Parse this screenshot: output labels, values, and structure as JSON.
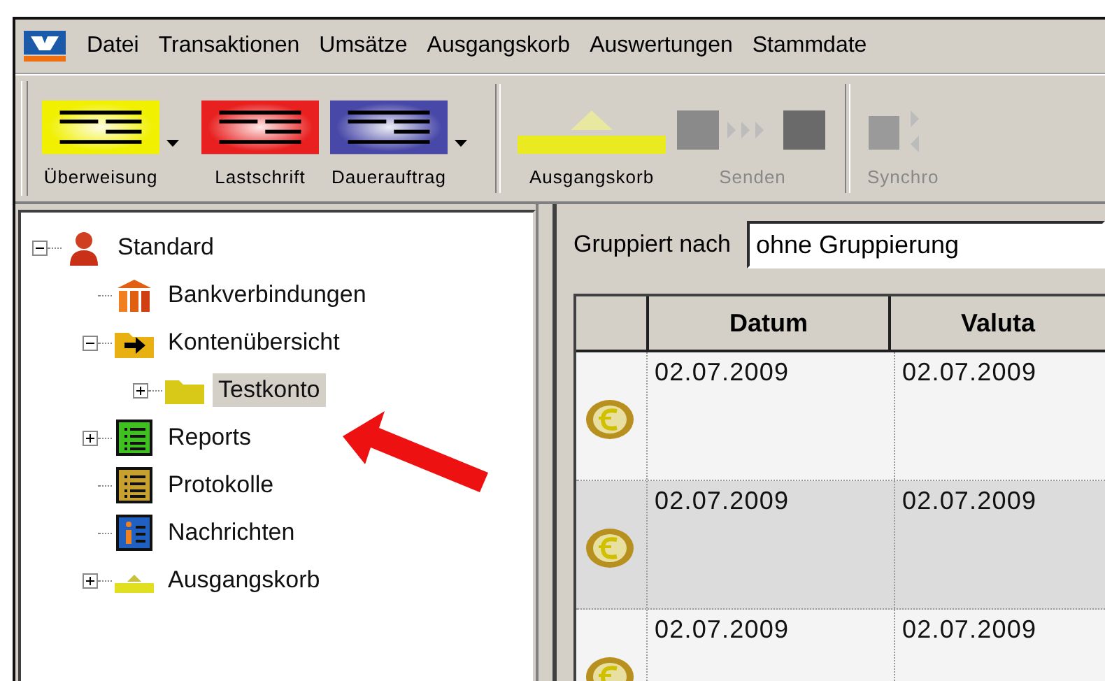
{
  "menu": [
    "Datei",
    "Transaktionen",
    "Umsätze",
    "Ausgangskorb",
    "Auswertungen",
    "Stammdate"
  ],
  "toolbar": [
    {
      "kind": "transfer",
      "color": "#f0f000",
      "label": "Überweisung",
      "dropdown": true,
      "disabled": false
    },
    {
      "kind": "transfer",
      "color": "#e82020",
      "label": "Lastschrift",
      "dropdown": false,
      "disabled": false
    },
    {
      "kind": "transfer",
      "color": "#4848a8",
      "label": "Dauerauftrag",
      "dropdown": true,
      "disabled": false
    },
    {
      "kind": "separator"
    },
    {
      "kind": "outbox",
      "label": "Ausgangskorb",
      "dropdown": false,
      "disabled": false
    },
    {
      "kind": "send",
      "label": "Senden",
      "dropdown": false,
      "disabled": true
    },
    {
      "kind": "separator"
    },
    {
      "kind": "sync",
      "label": "Synchro",
      "dropdown": false,
      "disabled": true
    }
  ],
  "tree": [
    {
      "kind": "person",
      "label": "Standard",
      "expandable": true,
      "expanded": true,
      "selected": false,
      "children": [
        {
          "kind": "bank",
          "label": "Bankverbindungen",
          "expandable": false,
          "selected": false
        },
        {
          "kind": "accounts",
          "label": "Kontenübersicht",
          "expandable": true,
          "expanded": true,
          "selected": false,
          "children": [
            {
              "kind": "folder",
              "label": "Testkonto",
              "expandable": true,
              "expanded": false,
              "selected": true
            }
          ]
        },
        {
          "kind": "reports",
          "label": "Reports",
          "expandable": true,
          "expanded": false,
          "selected": false
        },
        {
          "kind": "logs",
          "label": "Protokolle",
          "expandable": false,
          "selected": false
        },
        {
          "kind": "info",
          "label": "Nachrichten",
          "expandable": false,
          "selected": false
        },
        {
          "kind": "outbox",
          "label": "Ausgangskorb",
          "expandable": true,
          "expanded": false,
          "selected": false
        }
      ]
    }
  ],
  "group_by": {
    "label": "Gruppiert nach",
    "value": "ohne Gruppierung"
  },
  "table": {
    "columns": [
      "Datum",
      "Valuta"
    ],
    "rows": [
      {
        "datum": "02.07.2009",
        "valuta": "02.07.2009"
      },
      {
        "datum": "02.07.2009",
        "valuta": "02.07.2009"
      },
      {
        "datum": "02.07.2009",
        "valuta": "02.07.2009"
      }
    ]
  }
}
